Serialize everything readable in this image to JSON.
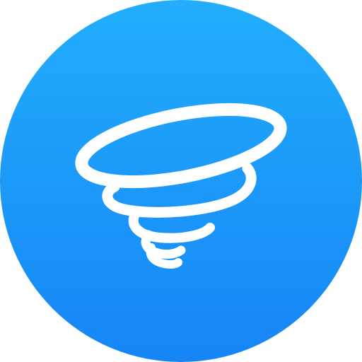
{
  "icon": {
    "name": "tornado-icon",
    "colors": {
      "gradient_top": "#22AEFC",
      "gradient_bottom": "#1685F6",
      "glyph": "#FFFFFF"
    }
  }
}
